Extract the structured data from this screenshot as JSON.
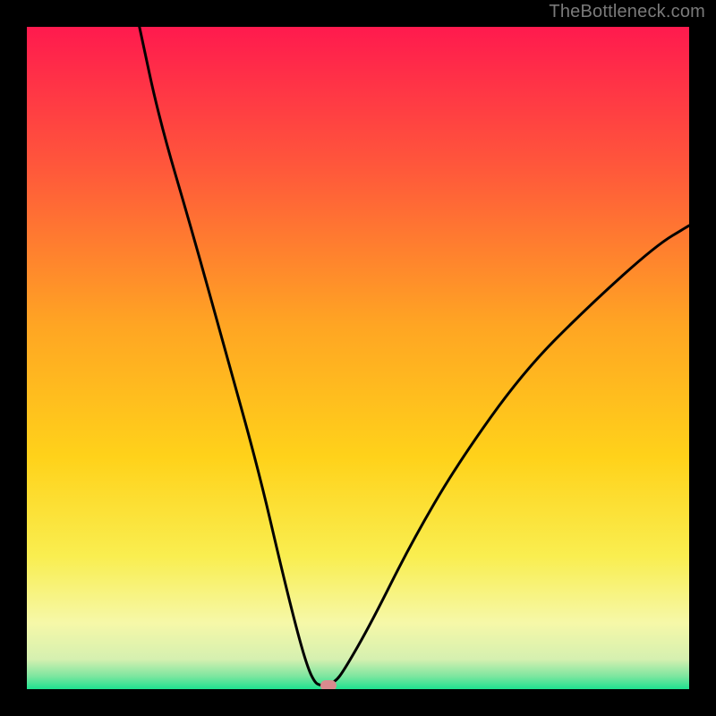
{
  "watermark": "TheBottleneck.com",
  "chart_data": {
    "type": "line",
    "title": "",
    "xlabel": "",
    "ylabel": "",
    "xlim": [
      0,
      100
    ],
    "ylim": [
      0,
      100
    ],
    "grid": false,
    "legend": false,
    "background_gradient": {
      "stops": [
        {
          "offset": 0.0,
          "color": "#ff1a4e"
        },
        {
          "offset": 0.22,
          "color": "#ff5a3a"
        },
        {
          "offset": 0.45,
          "color": "#ffa523"
        },
        {
          "offset": 0.65,
          "color": "#ffd21a"
        },
        {
          "offset": 0.8,
          "color": "#f9ee50"
        },
        {
          "offset": 0.9,
          "color": "#f6f8a8"
        },
        {
          "offset": 0.955,
          "color": "#d5f0b0"
        },
        {
          "offset": 0.98,
          "color": "#7fe6a0"
        },
        {
          "offset": 1.0,
          "color": "#1ee28f"
        }
      ]
    },
    "series": [
      {
        "name": "bottleneck-curve",
        "color": "#000000",
        "x": [
          17,
          20,
          25,
          30,
          35,
          38.5,
          41,
          42.5,
          43.5,
          44.2,
          44.8,
          46.5,
          48,
          52,
          58,
          65,
          75,
          85,
          95,
          100
        ],
        "y": [
          100,
          86,
          69,
          51,
          33,
          18,
          8,
          3,
          1,
          0.6,
          0.6,
          1,
          3,
          10,
          22,
          34,
          48,
          58,
          67,
          70
        ]
      }
    ],
    "marker": {
      "name": "optimal-point",
      "shape": "pill",
      "color": "#d98a8e",
      "x": 45.5,
      "y": 0.6
    }
  }
}
